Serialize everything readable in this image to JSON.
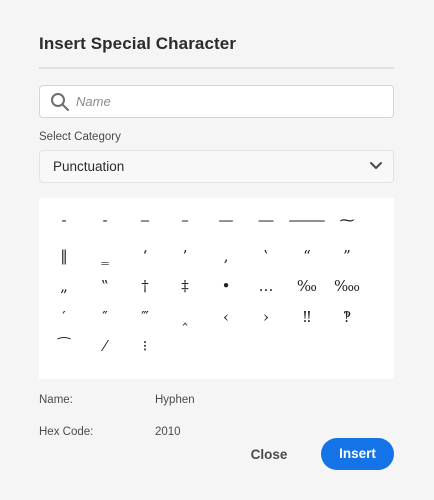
{
  "dialog": {
    "title": "Insert Special Character",
    "search": {
      "placeholder": "Name",
      "value": ""
    },
    "category": {
      "label": "Select Category",
      "selected": "Punctuation"
    },
    "characters": [
      "‐",
      "‑",
      "‒",
      "–",
      "—",
      "―",
      "⸻",
      "⁓",
      "‖",
      "‗",
      "‘",
      "’",
      "‚",
      "‛",
      "“",
      "”",
      "„",
      "‟",
      "†",
      "‡",
      "•",
      "…",
      "‰",
      "‱",
      "′",
      "″",
      "‴",
      "‸",
      "‹",
      "›",
      "‼",
      "‽",
      "⁀",
      "⁄",
      "⁝"
    ],
    "info": {
      "name_label": "Name:",
      "name_value": "Hyphen",
      "hex_label": "Hex Code:",
      "hex_value": "2010"
    },
    "buttons": {
      "close": "Close",
      "insert": "Insert"
    },
    "accent_color": "#1473e6"
  }
}
